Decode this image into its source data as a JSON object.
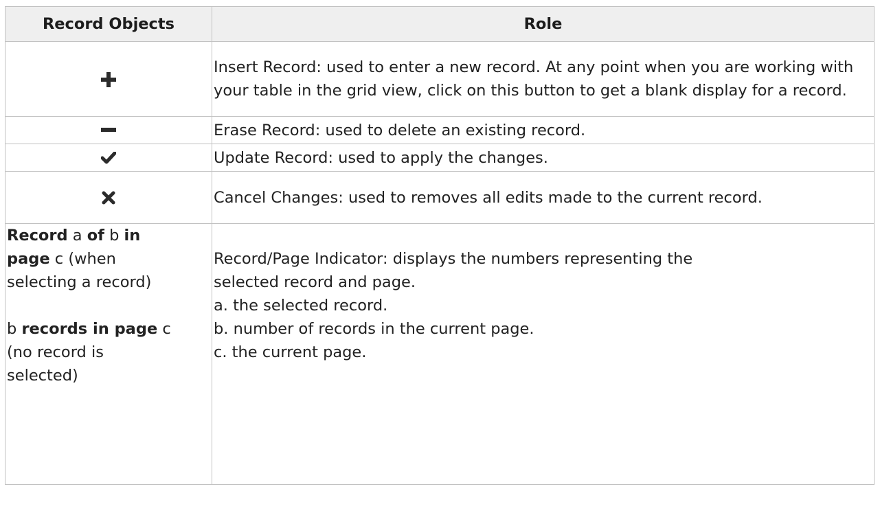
{
  "table": {
    "headers": {
      "objects": "Record Objects",
      "role": "Role"
    },
    "rows": [
      {
        "icon": "plus-icon",
        "role": "Insert Record: used to enter a new record. At any point when you are working with your table in the grid view, click on this button to get a blank display for a record."
      },
      {
        "icon": "minus-icon",
        "role": "Erase Record: used to delete an existing record."
      },
      {
        "icon": "check-icon",
        "role": "Update Record: used to apply the changes."
      },
      {
        "icon": "cross-icon",
        "role": "Cancel Changes: used to removes all edits made to the current record."
      }
    ],
    "indicator": {
      "object_lines": {
        "w_record": "Record",
        "v_a": " a ",
        "w_of": "of",
        "v_b": " b ",
        "w_in": "in",
        "w_page": "page",
        "v_c_when": " c (when",
        "when_selecting": "selecting a record)",
        "v_b2": "b ",
        "w_records_in_page": "records in page",
        "v_c2": " c",
        "no_record": "(no record is",
        "selected": "selected)"
      },
      "role_lines": [
        "Record/Page Indicator: displays the numbers representing the",
        "selected record and page.",
        "a. the selected record.",
        "b. number of records in the current page.",
        "c. the current page."
      ]
    }
  },
  "colors": {
    "icon": "#2b2b2b",
    "border": "#c2c2c2",
    "header_bg": "#efefef"
  }
}
